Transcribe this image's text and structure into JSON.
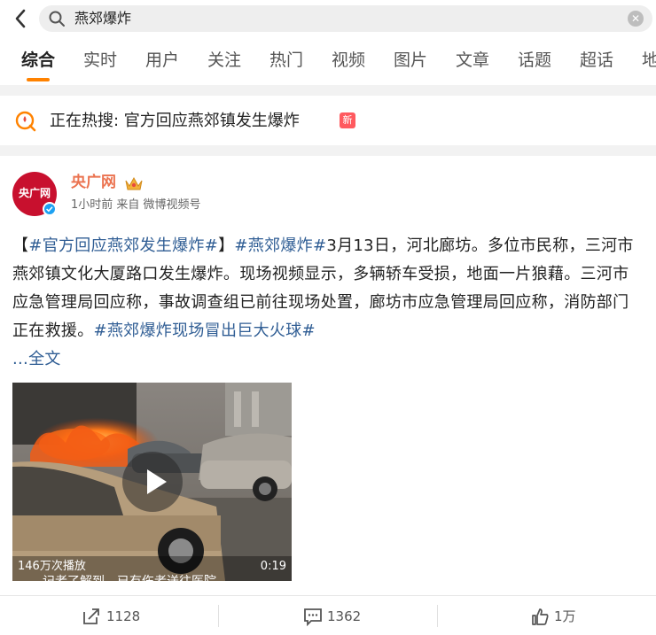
{
  "search": {
    "query": "燕郊爆炸"
  },
  "tabs": [
    "综合",
    "实时",
    "用户",
    "关注",
    "热门",
    "视频",
    "图片",
    "文章",
    "话题",
    "超话",
    "地"
  ],
  "hot": {
    "text": "正在热搜: 官方回应燕郊镇发生爆炸",
    "badge": "新"
  },
  "post": {
    "author": "央广网",
    "avatar_text": "央广网",
    "meta": "1小时前 来自 微博视频号",
    "body": [
      {
        "t": "【",
        "tag": false
      },
      {
        "t": "#官方回应燕郊发生爆炸#",
        "tag": true
      },
      {
        "t": "】",
        "tag": false
      },
      {
        "t": "#燕郊爆炸#",
        "tag": true
      },
      {
        "t": "3月13日，河北廊坊。多位市民称，三河市燕郊镇文化大厦路口发生爆炸。现场视频显示，多辆轿车受损，地面一片狼藉。三河市应急管理局回应称，事故调查组已前往现场处置，廊坊市应急管理局回应称，消防部门正在救援。",
        "tag": false
      },
      {
        "t": "#燕郊爆炸现场冒出巨大火球#",
        "tag": true
      }
    ],
    "more": "...全文",
    "video": {
      "plays": "146万次播放",
      "duration": "0:19",
      "subtitle": "记者了解到，已有伤者送往医院"
    }
  },
  "actions": {
    "share": "1128",
    "comment": "1362",
    "like": "1万"
  },
  "colors": {
    "accent": "#ff8200",
    "author": "#eb7350",
    "link": "#2f5d94"
  }
}
